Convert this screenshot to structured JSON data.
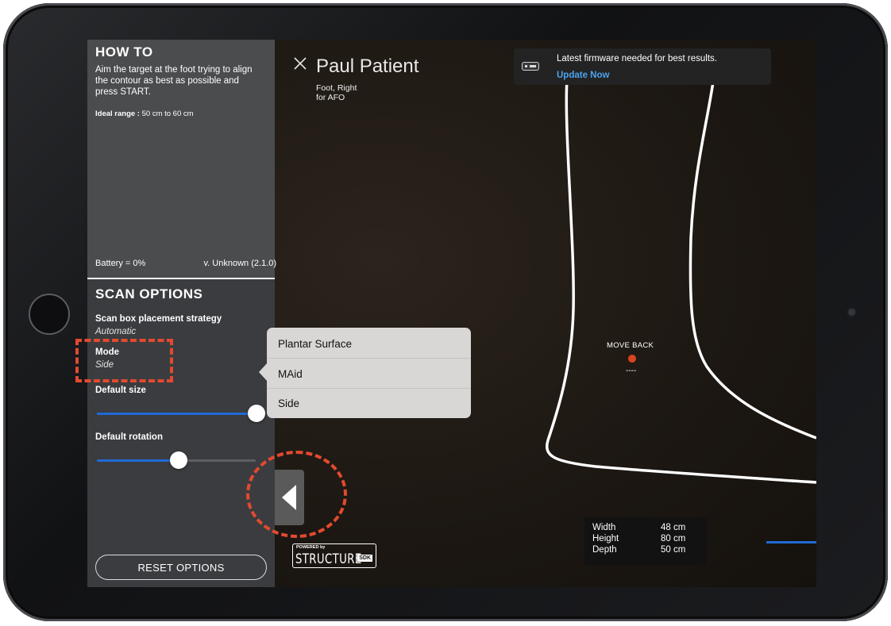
{
  "howto": {
    "title": "HOW TO",
    "instructions": "Aim the target at the foot trying to align the contour as best as possible and press START.",
    "ideal_label": "Ideal range :",
    "ideal_value": "50 cm to 60 cm",
    "battery": "Battery = 0%",
    "version": "v. Unknown (2.1.0)"
  },
  "scan_options": {
    "title": "SCAN OPTIONS",
    "placement_label": "Scan box placement strategy",
    "placement_value": "Automatic",
    "mode_label": "Mode",
    "mode_value": "Side",
    "default_size_label": "Default size",
    "default_size_level": 1.0,
    "default_rotation_label": "Default rotation",
    "default_rotation_level": 0.5,
    "reset_label": "RESET OPTIONS"
  },
  "patient": {
    "name": "Paul Patient",
    "body_part": "Foot, Right",
    "purpose": "for AFO"
  },
  "banner": {
    "message": "Latest firmware needed for best results.",
    "link": "Update Now"
  },
  "guidance": {
    "label": "MOVE BACK",
    "value": "----"
  },
  "dimensions": [
    {
      "label": "Width",
      "value": "48 cm"
    },
    {
      "label": "Height",
      "value": "80 cm"
    },
    {
      "label": "Depth",
      "value": "50 cm"
    }
  ],
  "sdk_logo": {
    "powered": "POWERED by",
    "name": "STRUCTURE",
    "suffix": "SDK"
  },
  "mode_popover": {
    "options": [
      "Plantar Surface",
      "MAid",
      "Side"
    ]
  },
  "colors": {
    "accent_blue": "#1f6ad6",
    "link_blue": "#4ba2f0",
    "annotation_red": "#e24a30",
    "indicator_orange": "#d9451f"
  },
  "icons": {
    "close": "close-icon",
    "collapse": "chevron-left-icon",
    "sensor": "sensor-icon"
  }
}
